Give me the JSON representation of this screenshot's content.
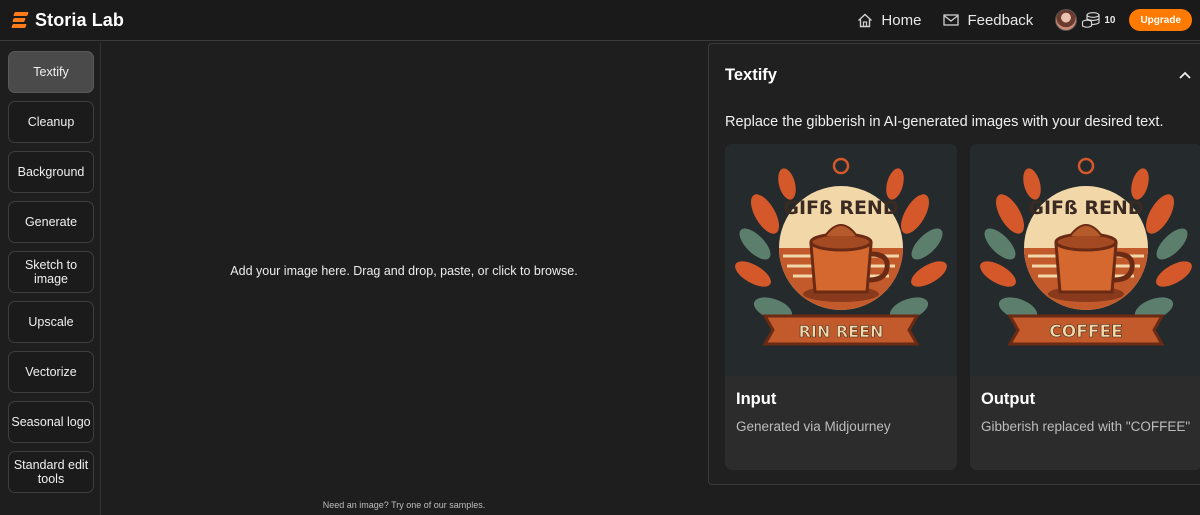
{
  "brand": {
    "name": "Storia Lab",
    "accent": "#ff7a1a"
  },
  "nav": {
    "home_label": "Home",
    "feedback_label": "Feedback",
    "credits": "10",
    "upgrade_label": "Upgrade",
    "upgrade_color": "#ff7a00"
  },
  "sidebar": {
    "active": "Textify",
    "tools": [
      {
        "label": "Textify"
      },
      {
        "label": "Cleanup"
      },
      {
        "label": "Background"
      },
      {
        "label": "Generate"
      },
      {
        "label": "Sketch to image"
      },
      {
        "label": "Upscale"
      },
      {
        "label": "Vectorize"
      },
      {
        "label": "Seasonal logo"
      },
      {
        "label": "Standard edit tools"
      }
    ]
  },
  "dropzone": {
    "prompt": "Add your image here. Drag and drop, paste, or click to browse.",
    "samples_hint": "Need an image? Try one of our samples."
  },
  "panel": {
    "title": "Textify",
    "description": "Replace the gibberish in AI-generated images with your desired text.",
    "cards": [
      {
        "title": "Input",
        "subtitle": "Generated via Midjourney",
        "art_top_text": "GIFß REND",
        "art_banner_text": "RIN REEN"
      },
      {
        "title": "Output",
        "subtitle": "Gibberish replaced with \"COFFEE\"",
        "art_top_text": "GIFß REND",
        "art_banner_text": "COFFEE"
      }
    ]
  }
}
